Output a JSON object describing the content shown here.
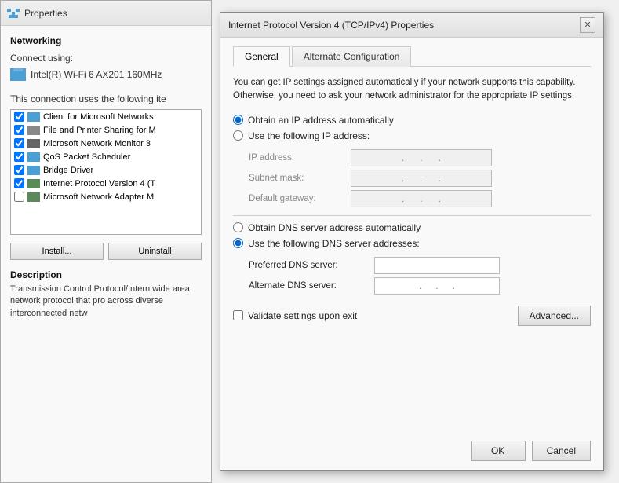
{
  "bg_window": {
    "title": "Properties",
    "networking_label": "Networking",
    "connect_using_label": "Connect using:",
    "adapter_name": "Intel(R) Wi-Fi 6 AX201 160MHz",
    "connection_uses_label": "This connection uses the following ite",
    "list_items": [
      {
        "checked": true,
        "label": "Client for Microsoft Networks"
      },
      {
        "checked": true,
        "label": "File and Printer Sharing for M"
      },
      {
        "checked": true,
        "label": "Microsoft Network Monitor 3"
      },
      {
        "checked": true,
        "label": "QoS Packet Scheduler"
      },
      {
        "checked": true,
        "label": "Bridge Driver"
      },
      {
        "checked": true,
        "label": "Internet Protocol Version 4 (T"
      },
      {
        "checked": false,
        "label": "Microsoft Network Adapter M"
      }
    ],
    "install_btn": "Install...",
    "uninstall_btn": "Uninstall",
    "description_label": "Description",
    "description_text": "Transmission Control Protocol/Intern wide area network protocol that pro across diverse interconnected netw"
  },
  "dialog": {
    "title": "Internet Protocol Version 4 (TCP/IPv4) Properties",
    "close_btn": "✕",
    "tabs": [
      {
        "label": "General",
        "active": true
      },
      {
        "label": "Alternate Configuration",
        "active": false
      }
    ],
    "description": "You can get IP settings assigned automatically if your network supports this capability. Otherwise, you need to ask your network administrator for the appropriate IP settings.",
    "ip_options": [
      {
        "id": "auto-ip",
        "label": "Obtain an IP address automatically",
        "selected": true
      },
      {
        "id": "manual-ip",
        "label": "Use the following IP address:",
        "selected": false
      }
    ],
    "ip_fields": [
      {
        "label": "IP address:",
        "placeholder": ". . ."
      },
      {
        "label": "Subnet mask:",
        "placeholder": ". . ."
      },
      {
        "label": "Default gateway:",
        "placeholder": ". . ."
      }
    ],
    "dns_options": [
      {
        "id": "auto-dns",
        "label": "Obtain DNS server address automatically",
        "selected": false
      },
      {
        "id": "manual-dns",
        "label": "Use the following DNS server addresses:",
        "selected": true
      }
    ],
    "dns_fields": [
      {
        "label": "Preferred DNS server:",
        "type": "plain"
      },
      {
        "label": "Alternate DNS server:",
        "type": "dots"
      }
    ],
    "validate_label": "Validate settings upon exit",
    "advanced_btn": "Advanced...",
    "ok_btn": "OK",
    "cancel_btn": "Cancel"
  }
}
